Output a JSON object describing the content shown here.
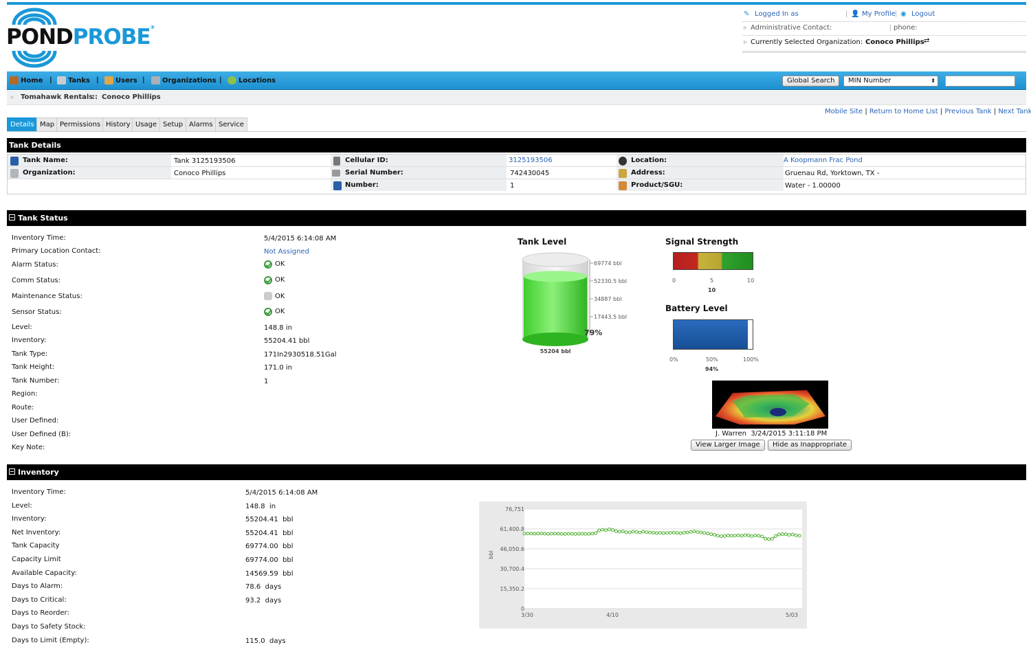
{
  "logo": {
    "pond": "POND",
    "probe": "PROBE"
  },
  "header": {
    "logged_in_as": "Logged In as",
    "my_profile": "My Profile",
    "logout": "Logout",
    "admin_contact": "Administrative Contact:",
    "phone": "phone:",
    "selected_org_label": "Currently Selected Organization:",
    "selected_org": "Conoco Phillips"
  },
  "nav": {
    "items": [
      "Home",
      "Tanks",
      "Users",
      "Organizations",
      "Locations"
    ],
    "global_search": "Global Search",
    "search_type": "MIN Number",
    "search_value": ""
  },
  "breadcrumb": {
    "a": "Tomahawk Rentals",
    "sep": "::",
    "b": "Conoco Phillips"
  },
  "links": {
    "mobile": "Mobile Site",
    "return": "Return to Home List",
    "prev": "Previous Tank",
    "next": "Next Tank"
  },
  "tabs": [
    "Details",
    "Map",
    "Permissions",
    "History",
    "Usage",
    "Setup",
    "Alarms",
    "Service"
  ],
  "tank_details": {
    "title": "Tank Details",
    "tank_name_label": "Tank Name:",
    "tank_name": "Tank 3125193506",
    "org_label": "Organization:",
    "org": "Conoco Phillips",
    "cell_label": "Cellular ID:",
    "cell": "3125193506",
    "serial_label": "Serial Number:",
    "serial": "742430045",
    "number_label": "Number:",
    "number": "1",
    "location_label": "Location:",
    "location": "A Koopmann Frac Pond",
    "address_label": "Address:",
    "address": "Gruenau Rd, Yorktown, TX -",
    "product_label": "Product/SGU:",
    "product": "Water - 1.00000"
  },
  "tank_status": {
    "title": "Tank Status",
    "rows": [
      {
        "label": "Inventory Time:",
        "value": "5/4/2015 6:14:08 AM"
      },
      {
        "label": "Primary Location Contact:",
        "value": "Not Assigned"
      },
      {
        "label": "Alarm Status:",
        "value": "OK"
      },
      {
        "label": "Comm Status:",
        "value": "OK"
      },
      {
        "label": "Maintenance Status:",
        "value": "OK"
      },
      {
        "label": "Sensor Status:",
        "value": "OK"
      },
      {
        "label": "Level:",
        "value": "148.8  in"
      },
      {
        "label": "Inventory:",
        "value": "55204.41  bbl"
      },
      {
        "label": "Tank Type:",
        "value": "171In2930518.51Gal"
      },
      {
        "label": "Tank Height:",
        "value": "171.0  in"
      },
      {
        "label": "Tank Number:",
        "value": "1"
      },
      {
        "label": "Region:",
        "value": ""
      },
      {
        "label": "Route:",
        "value": ""
      },
      {
        "label": "User Defined:",
        "value": ""
      },
      {
        "label": "User Defined (B):",
        "value": ""
      },
      {
        "label": "Key Note:",
        "value": ""
      }
    ]
  },
  "tank_level": {
    "title": "Tank Level",
    "scale": [
      "69774 bbl",
      "52330.5 bbl",
      "34887 bbl",
      "17443.5 bbl"
    ],
    "percent_text": "79%",
    "fill_fraction": 0.79,
    "volume": "55204 bbl"
  },
  "signal": {
    "title": "Signal Strength",
    "ticks": [
      "0",
      "5",
      "10"
    ],
    "value": "10"
  },
  "battery": {
    "title": "Battery Level",
    "ticks": [
      "0%",
      "50%",
      "100%"
    ],
    "value": "94%",
    "fill_fraction": 0.94
  },
  "photo": {
    "caption": "J. Warren  3/24/2015 3:11:18 PM",
    "view": "View Larger Image",
    "hide": "Hide as Inappropriate"
  },
  "inventory": {
    "title": "Inventory",
    "rows": [
      {
        "label": "Inventory Time:",
        "value": "5/4/2015 6:14:08 AM"
      },
      {
        "label": "Level:",
        "value": "148.8  in"
      },
      {
        "label": "Inventory:",
        "value": "55204.41  bbl"
      },
      {
        "label": "Net Inventory:",
        "value": "55204.41  bbl"
      },
      {
        "label": "Tank Capacity",
        "value": "69774.00  bbl"
      },
      {
        "label": "Capacity Limit",
        "value": "69774.00  bbl"
      },
      {
        "label": "Available Capacity:",
        "value": "14569.59  bbl"
      },
      {
        "label": "Days to Alarm:",
        "value": "78.6  days"
      },
      {
        "label": "Days to Critical:",
        "value": "93.2  days"
      },
      {
        "label": "Days to Reorder:",
        "value": ""
      },
      {
        "label": "Days to Safety Stock:",
        "value": ""
      },
      {
        "label": "Days to Limit (Empty):",
        "value": "115.0  days"
      }
    ]
  },
  "chart_data": {
    "type": "line",
    "ylabel": "bbl",
    "y_ticks": [
      "76,751",
      "61,400.8",
      "46,050.6",
      "30,700.4",
      "15,350.2",
      "0"
    ],
    "ylim": [
      0,
      76751
    ],
    "x_ticks": [
      "3/30",
      "4/10",
      "5/03"
    ],
    "color": "#4caf2e",
    "series": [
      {
        "values": [
          57800,
          57900,
          57800,
          57700,
          57800,
          57900,
          57700,
          57600,
          57700,
          57800,
          57700,
          57600,
          57500,
          57700,
          57600,
          57500,
          57600,
          57700,
          57500,
          57600,
          57800,
          58200,
          60200,
          60800,
          60400,
          61100,
          60600,
          59700,
          59300,
          59500,
          58900,
          58700,
          59300,
          59100,
          58600,
          59200,
          58900,
          58600,
          58400,
          58200,
          58400,
          58100,
          58300,
          58400,
          58600,
          58300,
          58100,
          58500,
          58700,
          59100,
          59500,
          59100,
          58700,
          58300,
          57900,
          57300,
          56900,
          56100,
          55800,
          56000,
          56300,
          56100,
          56200,
          56500,
          56100,
          56600,
          56400,
          55900,
          56300,
          56100,
          55600,
          53900,
          53500,
          53800,
          55900,
          57100,
          57400,
          57300,
          56800,
          57100,
          56500,
          56100
        ]
      }
    ]
  }
}
